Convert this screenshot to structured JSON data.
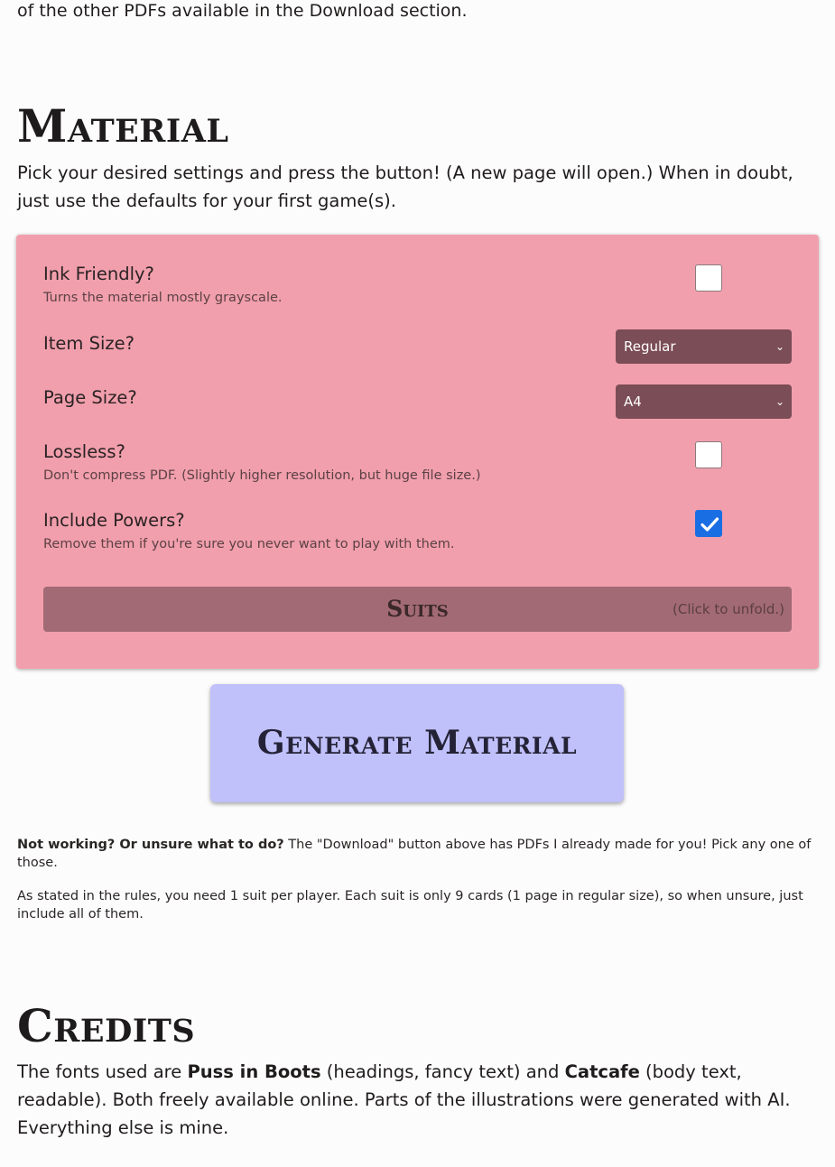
{
  "intro_tail": "of the other PDFs available in the Download section.",
  "material": {
    "heading": "Material",
    "intro": "Pick your desired settings and press the button! (A new page will open.) When in doubt, just use the defaults for your first game(s)."
  },
  "settings": {
    "ink_friendly": {
      "label": "Ink Friendly?",
      "description": "Turns the material mostly grayscale.",
      "checked": false
    },
    "item_size": {
      "label": "Item Size?",
      "value": "Regular"
    },
    "page_size": {
      "label": "Page Size?",
      "value": "A4"
    },
    "lossless": {
      "label": "Lossless?",
      "description": "Don't compress PDF. (Slightly higher resolution, but huge file size.)",
      "checked": false
    },
    "include_powers": {
      "label": "Include Powers?",
      "description": "Remove them if you're sure you never want to play with them.",
      "checked": true
    },
    "suits": {
      "title": "Suits",
      "hint": "(Click to unfold.)"
    }
  },
  "generate_button": {
    "label": "Generate Material"
  },
  "notes": {
    "not_working_bold": "Not working? Or unsure what to do?",
    "not_working_rest": " The \"Download\" button above has PDFs I already made for you! Pick any one of those.",
    "suits_note": "As stated in the rules, you need 1 suit per player. Each suit is only 9 cards (1 page in regular size), so when unsure, just include all of them."
  },
  "credits": {
    "heading": "Credits",
    "text_1": "The fonts used are ",
    "font_1": "Puss in Boots",
    "text_2": " (headings, fancy text) and ",
    "font_2": "Catcafe",
    "text_3": " (body text, readable). Both freely available online. Parts of the illustrations were generated with AI. Everything else is mine."
  },
  "icons": {
    "checkmark": "checkmark-icon",
    "chevron": "chevron-down-icon"
  },
  "colors": {
    "panel_bg": "#f19fac",
    "select_bg": "#7b4d56",
    "suits_bg": "#a26a74",
    "generate_bg": "#c0c0fb",
    "checkbox_checked": "#1a6ee4"
  }
}
